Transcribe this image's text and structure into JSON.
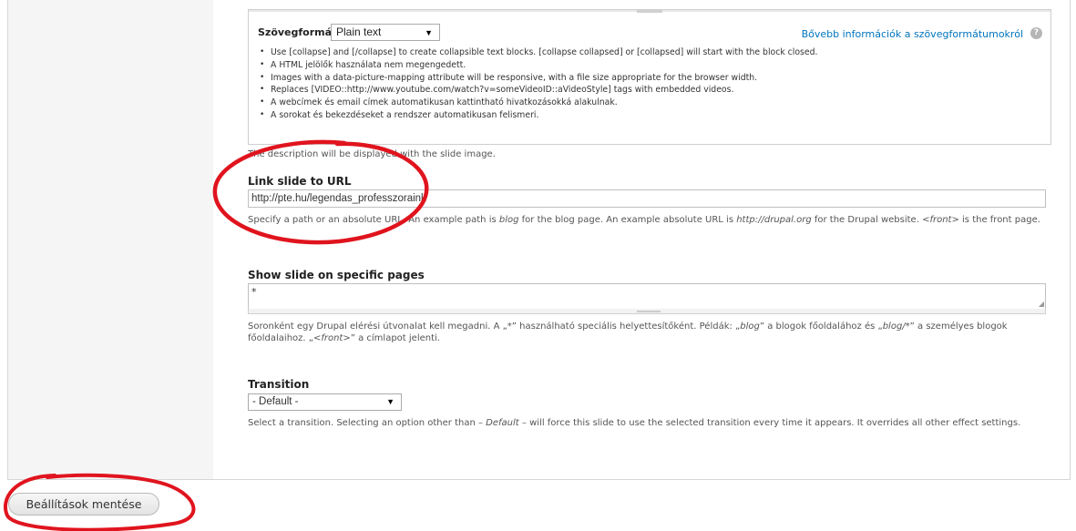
{
  "text_format": {
    "label": "Szövegformátum",
    "selected": "Plain text",
    "more_info_link": "Bővebb információk a szövegformátumokról",
    "tips": [
      "Use [collapse] and [/collapse] to create collapsible text blocks. [collapse collapsed] or [collapsed] will start with the block closed.",
      "A HTML jelölők használata nem megengedett.",
      "Images with a data-picture-mapping attribute will be responsive, with a file size appropriate for the browser width.",
      "Replaces [VIDEO::http://www.youtube.com/watch?v=someVideoID::aVideoStyle] tags with embedded videos.",
      "A webcímek és email címek automatikusan kattintható hivatkozásokká alakulnak.",
      "A sorokat és bekezdéseket a rendszer automatikusan felismeri."
    ]
  },
  "description_note": "The description will be displayed with the slide image.",
  "link_slide": {
    "label": "Link slide to URL",
    "value": "http://pte.hu/legendas_professzoraink",
    "help": {
      "part1": "Specify a path or an absolute URL. An example path is ",
      "example_path": "blog",
      "part2": " for the blog page. An example absolute URL is ",
      "example_url": "http://drupal.org",
      "part3": " for the Drupal website. ",
      "front": "<front>",
      "part4": " is the front page."
    }
  },
  "show_on_pages": {
    "label": "Show slide on specific pages",
    "value": "*",
    "help": {
      "part1": "Soronként egy Drupal elérési útvonalat kell megadni. A „*” használható speciális helyettesítőként. Példák: „",
      "ex1": "blog",
      "part2": "” a blogok főoldalához és „",
      "ex2": "blog/*",
      "part3": "” a személyes blogok főoldalaihoz. „",
      "ex3": "<front>",
      "part4": "” a címlapot jelenti."
    }
  },
  "transition": {
    "label": "Transition",
    "selected": "- Default -",
    "help_part1": "Select a transition. Selecting an option other than ",
    "help_default": "– Default –",
    "help_part2": " will force this slide to use the selected transition every time it appears. It overrides all other effect settings."
  },
  "save_button": "Beállítások mentése",
  "colors": {
    "link": "#0074bd",
    "annotation": "#e0141e"
  }
}
